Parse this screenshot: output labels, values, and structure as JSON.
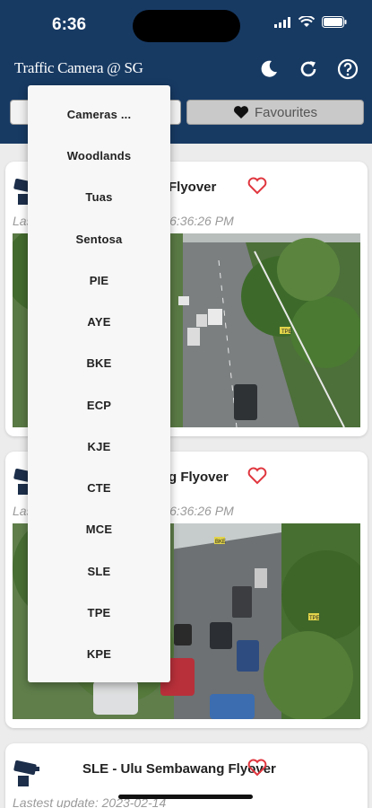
{
  "status": {
    "time": "6:36"
  },
  "app": {
    "title": "Traffic Camera @ SG"
  },
  "tabs": {
    "favourites_label": "Favourites"
  },
  "menu": {
    "items": [
      "Cameras ...",
      "Woodlands",
      "Tuas",
      "Sentosa",
      "PIE",
      "AYE",
      "BKE",
      "ECP",
      "KJE",
      "CTE",
      "MCE",
      "SLE",
      "TPE",
      "KPE"
    ]
  },
  "cards": [
    {
      "title": "Flyover",
      "updated": "Lastest update: 2023-02-14 6:36:26 PM",
      "visible_updated": "-14 6:36:26 PM"
    },
    {
      "title": "g Flyover",
      "updated": "Lastest update: 2023-02-14 6:36:26 PM",
      "visible_updated": "-14 6:36:26 PM"
    },
    {
      "title": "SLE - Ulu Sembawang Flyover",
      "updated": "Lastest update: 2023-02-14"
    }
  ],
  "camera_labels": {
    "tpe": "TPE",
    "bke": "BKE"
  },
  "colors": {
    "header": "#173a63",
    "heart": "#e0373f"
  }
}
